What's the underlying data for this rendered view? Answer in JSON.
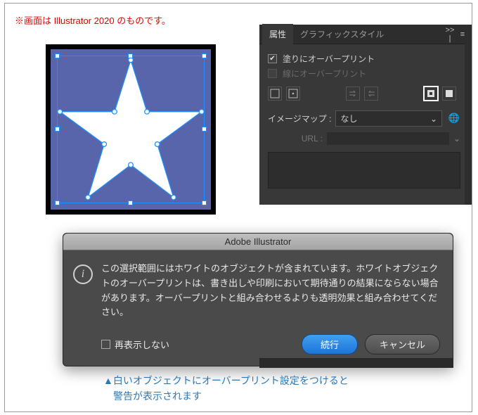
{
  "note_top": "※画面は Illustrator 2020 のものです。",
  "caption_line1": "▲白いオブジェクトにオーバープリント設定をつけると",
  "caption_line2": "警告が表示されます",
  "panel": {
    "tab_attributes": "属性",
    "tab_graphic": "グラフィックスタイル",
    "collapse": ">> |",
    "menu": "≡",
    "fill_overprint_label": "塗りにオーバープリント",
    "stroke_overprint_label": "線にオーバープリント",
    "imagemap_label": "イメージマップ :",
    "imagemap_value": "なし",
    "url_label": "URL :"
  },
  "dialog": {
    "title": "Adobe Illustrator",
    "message": "この選択範囲にはホワイトのオブジェクトが含まれています。ホワイトオブジェクトのオーバープリントは、書き出しや印刷において期待通りの結果にならない場合があります。オーバープリントと組み合わせるよりも透明効果と組み合わせてください。",
    "dont_show_label": "再表示しない",
    "continue_label": "続行",
    "cancel_label": "キャンセル"
  }
}
